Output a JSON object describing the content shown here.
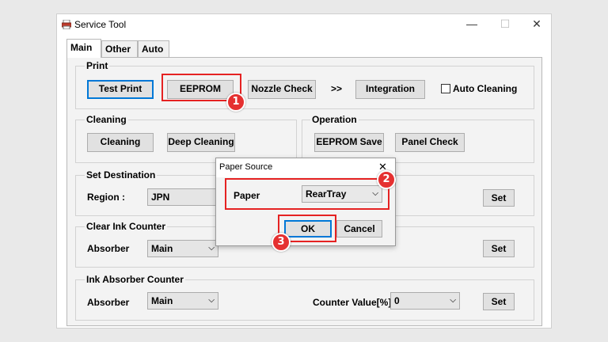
{
  "window": {
    "title": "Service Tool",
    "minimize": "—",
    "maximize": "☐",
    "close": "✕"
  },
  "tabs": [
    "Main",
    "Other",
    "Auto"
  ],
  "print_group": {
    "label": "Print",
    "test_print": "Test Print",
    "eeprom": "EEPROM",
    "nozzle_check": "Nozzle Check",
    "arrows": ">>",
    "integration": "Integration",
    "auto_cleaning": "Auto Cleaning"
  },
  "cleaning_group": {
    "label": "Cleaning",
    "cleaning": "Cleaning",
    "deep_cleaning": "Deep Cleaning"
  },
  "operation_group": {
    "label": "Operation",
    "eeprom_save": "EEPROM Save",
    "panel_check": "Panel Check"
  },
  "set_destination": {
    "label": "Set Destination",
    "region_label": "Region :",
    "region_value": "JPN",
    "set": "Set"
  },
  "clear_ink": {
    "label": "Clear Ink Counter",
    "absorber_label": "Absorber",
    "absorber_value": "Main",
    "set": "Set"
  },
  "ink_absorber": {
    "label": "Ink Absorber Counter",
    "absorber_label": "Absorber",
    "absorber_value": "Main",
    "counter_label": "Counter Value[%]",
    "counter_value": "0",
    "set": "Set"
  },
  "dialog": {
    "title": "Paper Source",
    "close": "✕",
    "paper_label": "Paper",
    "paper_value": "RearTray",
    "ok": "OK",
    "cancel": "Cancel"
  },
  "badges": [
    "1",
    "2",
    "3"
  ],
  "colors": {
    "highlight": "#e52222",
    "badge": "#e53030",
    "focus": "#0078d7"
  }
}
